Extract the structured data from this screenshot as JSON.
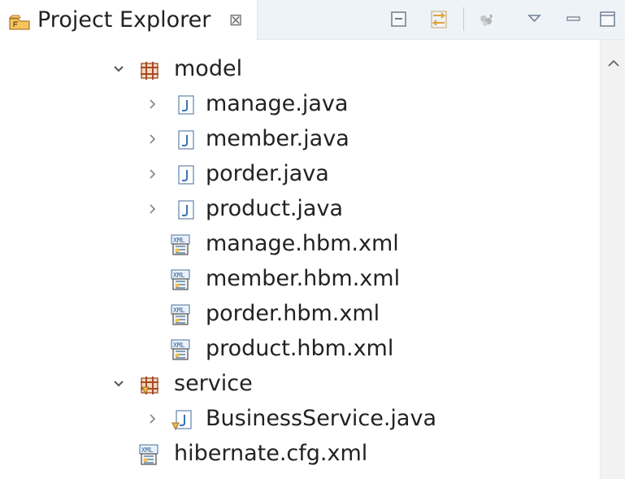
{
  "view": {
    "title": "Project Explorer",
    "close_glyph": "⊠"
  },
  "toolbar": {
    "items": [
      {
        "name": "collapse-all-icon"
      },
      {
        "name": "link-with-editor-icon"
      },
      {
        "name": "filter-icon"
      },
      {
        "name": "view-menu-icon"
      },
      {
        "name": "minimize-icon"
      },
      {
        "name": "maximize-icon"
      }
    ]
  },
  "tree": {
    "items": [
      {
        "label": "model",
        "type": "package",
        "state": "expanded"
      },
      {
        "label": "manage.java",
        "type": "java",
        "state": "collapsed"
      },
      {
        "label": "member.java",
        "type": "java",
        "state": "collapsed"
      },
      {
        "label": "porder.java",
        "type": "java",
        "state": "collapsed"
      },
      {
        "label": "product.java",
        "type": "java",
        "state": "collapsed"
      },
      {
        "label": "manage.hbm.xml",
        "type": "xml",
        "state": "none"
      },
      {
        "label": "member.hbm.xml",
        "type": "xml",
        "state": "none"
      },
      {
        "label": "porder.hbm.xml",
        "type": "xml",
        "state": "none"
      },
      {
        "label": "product.hbm.xml",
        "type": "xml",
        "state": "none"
      },
      {
        "label": "service",
        "type": "package",
        "state": "expanded"
      },
      {
        "label": "BusinessService.java",
        "type": "java",
        "state": "collapsed"
      },
      {
        "label": "hibernate.cfg.xml",
        "type": "xml",
        "state": "none"
      }
    ]
  },
  "colors": {
    "package_icon": "#a54b25",
    "java_icon": "#3a73b8",
    "xml_icon": "#2f5f93",
    "toolbar_background": "#eef3f8"
  }
}
